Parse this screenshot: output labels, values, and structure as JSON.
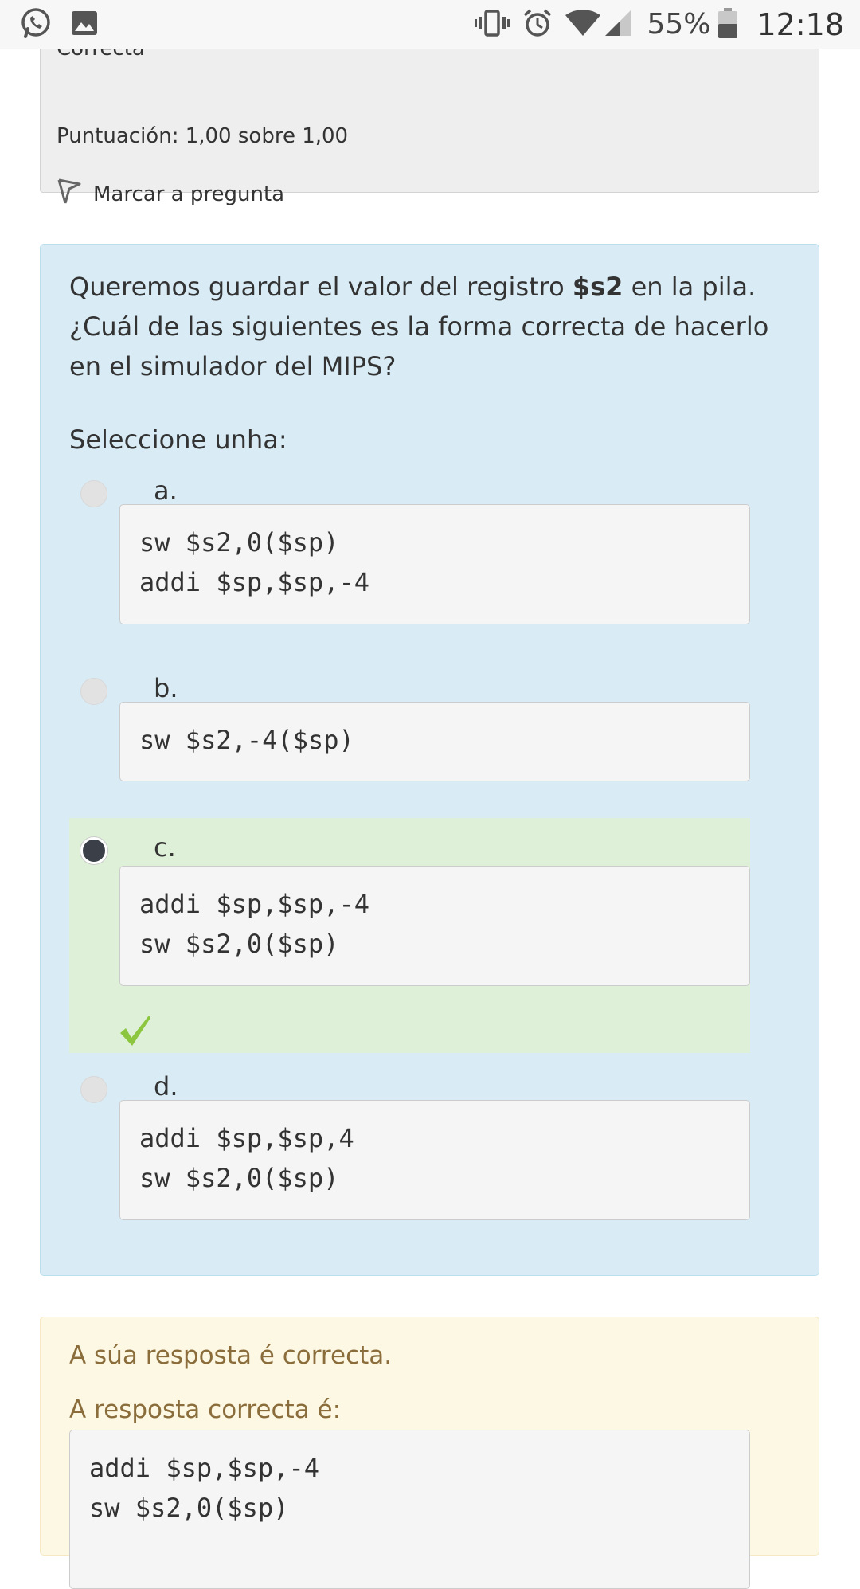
{
  "status_bar": {
    "left_icons": [
      "whatsapp-icon",
      "image-icon"
    ],
    "right_icons": [
      "vibrate-icon",
      "alarm-icon",
      "wifi-icon",
      "signal-icon",
      "battery-icon"
    ],
    "battery": "55%",
    "time": "12:18"
  },
  "previous_question": {
    "state": "Correcta",
    "score": "Puntuación: 1,00 sobre 1,00",
    "flag_label": "Marcar a pregunta"
  },
  "question": {
    "text_before": "Queremos guardar el valor del registro ",
    "text_bold": "$s2",
    "text_after": " en la pila. ¿Cuál de las siguientes es la forma correcta de hacerlo en el simulador del MIPS?",
    "prompt": "Seleccione unha:",
    "options": [
      {
        "letter": "a.",
        "lines": [
          "sw $s2,0($sp)",
          "addi $sp,$sp,-4"
        ],
        "selected": false,
        "correct": false
      },
      {
        "letter": "b.",
        "lines": [
          "sw $s2,-4($sp)"
        ],
        "selected": false,
        "correct": false
      },
      {
        "letter": "c.",
        "lines": [
          "addi $sp,$sp,-4",
          "sw $s2,0($sp)"
        ],
        "selected": true,
        "correct": true
      },
      {
        "letter": "d.",
        "lines": [
          "addi $sp,$sp,4",
          "sw $s2,0($sp)"
        ],
        "selected": false,
        "correct": false
      }
    ],
    "correct_icon": "checkmark-icon",
    "colors": {
      "question_bg": "#d9ecf6",
      "correct_bg": "#dff0d8",
      "check": "#8cc63f"
    }
  },
  "feedback": {
    "result": "A súa resposta é correcta.",
    "answer_label": "A resposta correcta é:",
    "answer_lines": [
      "addi $sp,$sp,-4",
      "sw $s2,0($sp)"
    ],
    "colors": {
      "bg": "#fcf8e3",
      "text": "#8a6d3b"
    }
  }
}
